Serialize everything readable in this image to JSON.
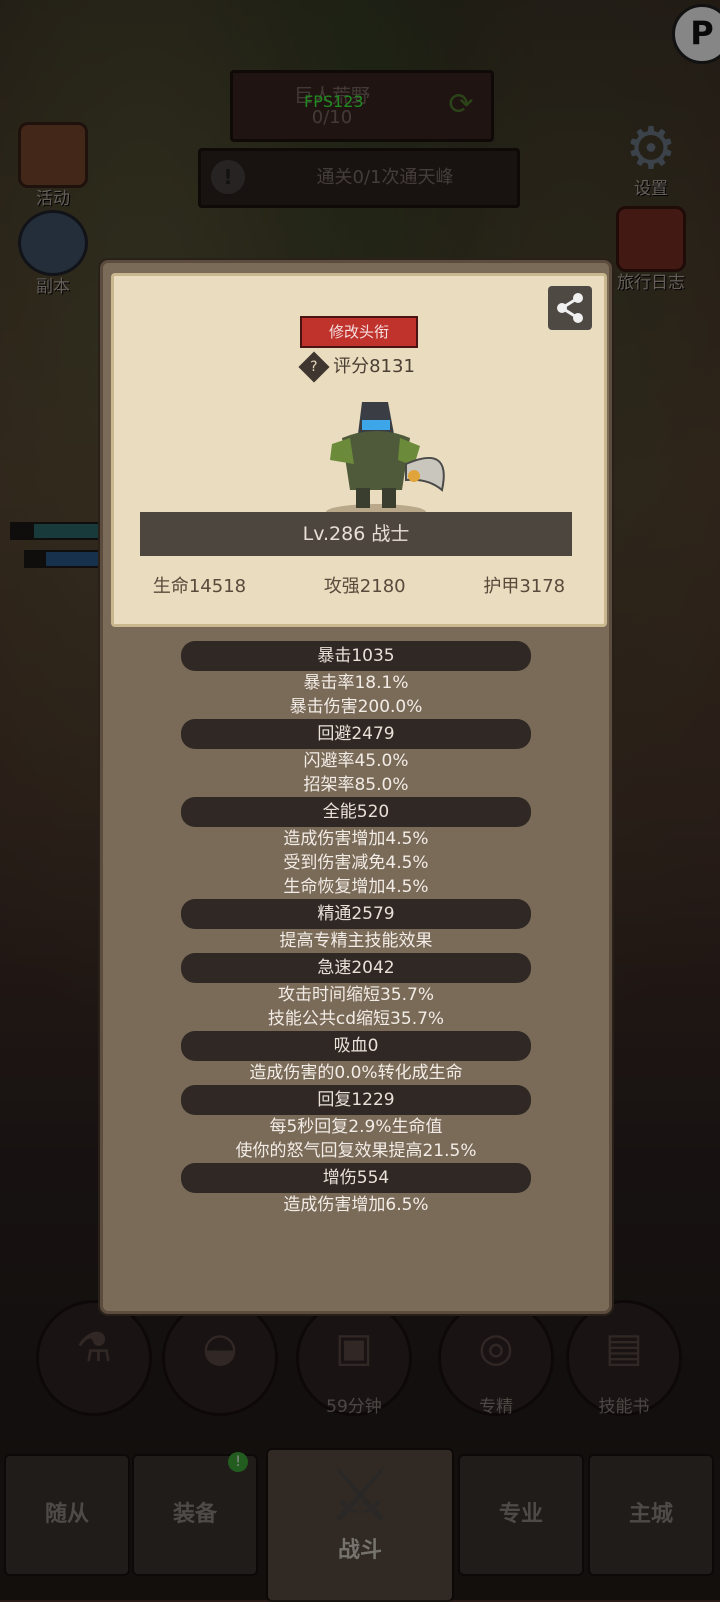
{
  "header": {
    "stage_name": "巨人荒野",
    "stage_progress": "0/10",
    "fps": "FPS123",
    "quest_text": "通关0/1次通天峰"
  },
  "side": {
    "activity": "活动",
    "dungeon": "副本",
    "settings": "设置",
    "travel_log": "旅行日志",
    "profile_glyph": "P"
  },
  "bottom_buttons": {
    "specialize": "专精",
    "skill_book": "技能书",
    "timer": "59分钟"
  },
  "nav": {
    "followers": "随从",
    "equipment": "装备",
    "battle": "战斗",
    "profession": "专业",
    "main_city": "主城",
    "equipment_badge": "!"
  },
  "card": {
    "edit_title_button": "修改头衔",
    "score": "评分8131",
    "level_class": "Lv.286 战士",
    "hp": "生命14518",
    "attack": "攻强2180",
    "armor": "护甲3178"
  },
  "attributes": [
    {
      "header": "暴击1035",
      "lines": [
        "暴击率18.1%",
        "暴击伤害200.0%"
      ]
    },
    {
      "header": "回避2479",
      "lines": [
        "闪避率45.0%",
        "招架率85.0%"
      ]
    },
    {
      "header": "全能520",
      "lines": [
        "造成伤害增加4.5%",
        "受到伤害减免4.5%",
        "生命恢复增加4.5%"
      ]
    },
    {
      "header": "精通2579",
      "lines": [
        "提高专精主技能效果"
      ]
    },
    {
      "header": "急速2042",
      "lines": [
        "攻击时间缩短35.7%",
        "技能公共cd缩短35.7%"
      ]
    },
    {
      "header": "吸血0",
      "lines": [
        "造成伤害的0.0%转化成生命"
      ]
    },
    {
      "header": "回复1229",
      "lines": [
        "每5秒回复2.9%生命值",
        "使你的怒气回复效果提高21.5%"
      ]
    },
    {
      "header": "增伤554",
      "lines": [
        "造成伤害增加6.5%"
      ]
    }
  ]
}
